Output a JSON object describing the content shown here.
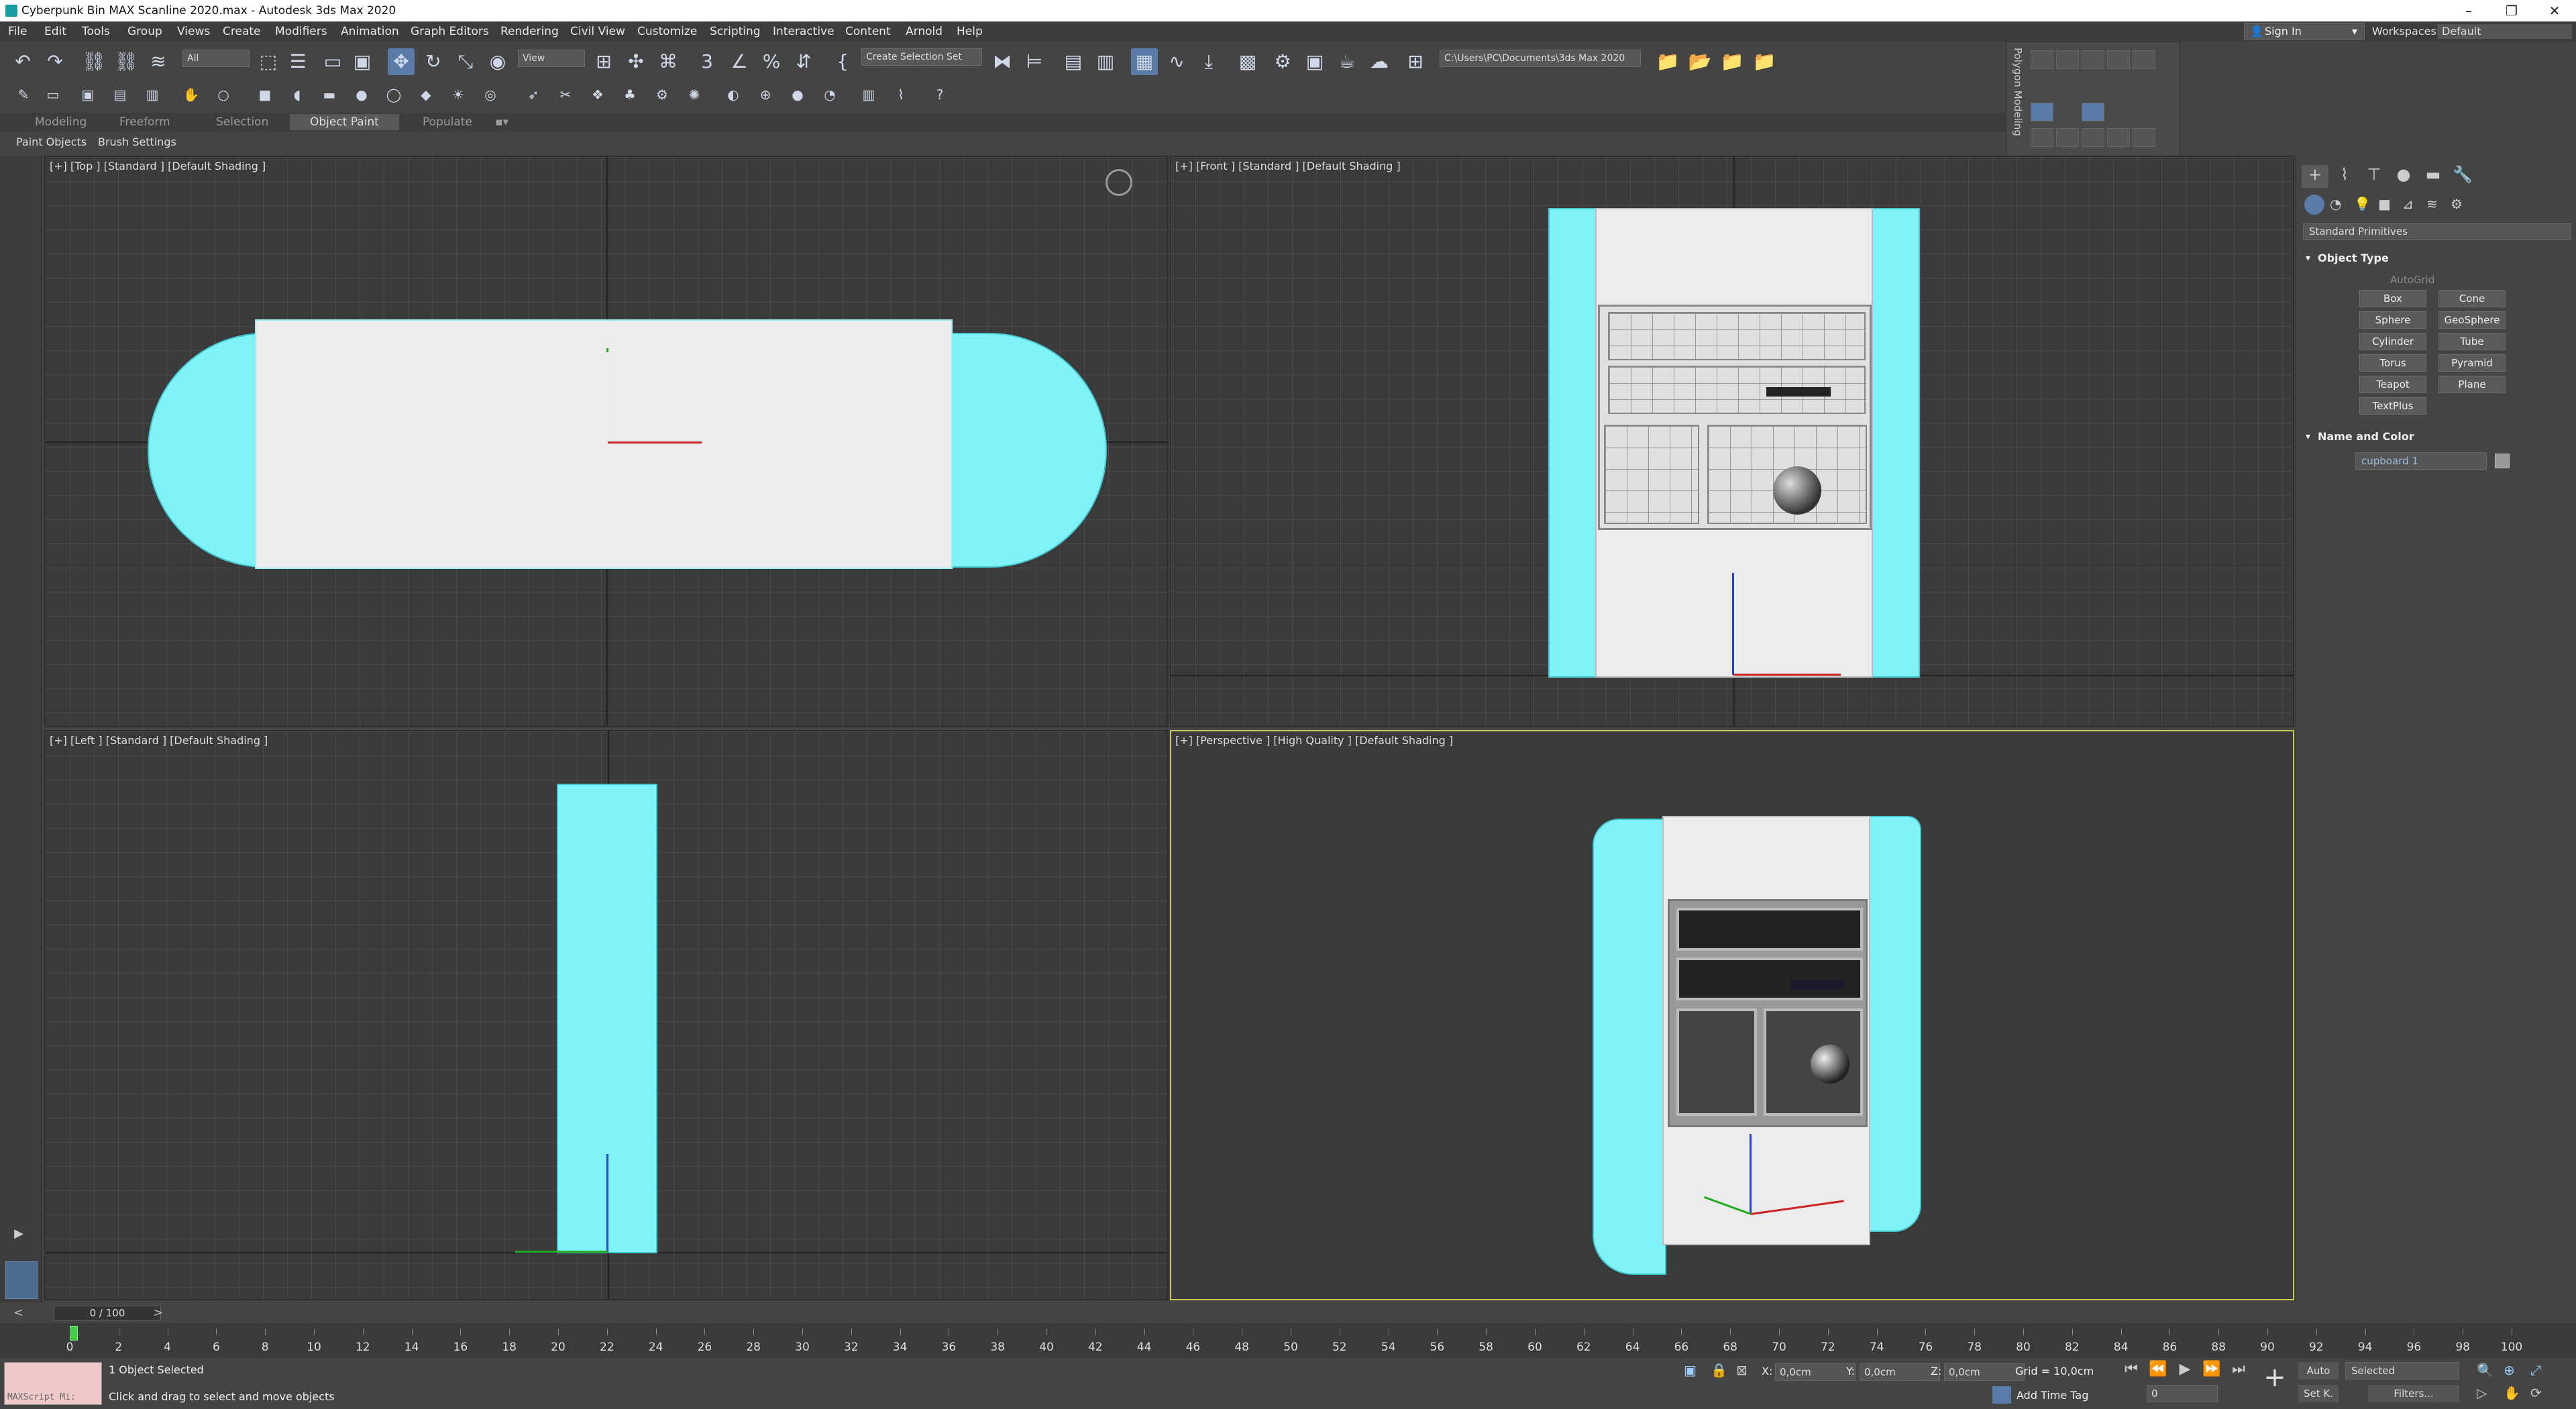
{
  "window": {
    "title": "Cyberpunk Bin MAX Scanline 2020.max - Autodesk 3ds Max 2020",
    "minimize": "–",
    "restore": "❐",
    "close": "✕"
  },
  "menu": [
    "File",
    "Edit",
    "Tools",
    "Group",
    "Views",
    "Create",
    "Modifiers",
    "Animation",
    "Graph Editors",
    "Rendering",
    "Civil View",
    "Customize",
    "Scripting",
    "Interactive",
    "Content",
    "Arnold",
    "Help"
  ],
  "account": {
    "signin": "Sign In",
    "workspaces_label": "Workspaces:",
    "workspace_value": "Default"
  },
  "toolbar": {
    "filter_value": "All",
    "refcoord_value": "View",
    "selection_set_placeholder": "Create Selection Set",
    "project_path": "C:\\Users\\PC\\Documents\\3ds Max 2020"
  },
  "ribbon": {
    "tabs": [
      "Modeling",
      "Freeform",
      "Selection",
      "Object Paint",
      "Populate"
    ],
    "active_tab": "Object Paint",
    "sub": [
      "Paint Objects",
      "Brush Settings"
    ],
    "polygon_panel": "Polygon Modeling"
  },
  "viewports": {
    "top": "[+] [Top ] [Standard ] [Default Shading ]",
    "front": "[+] [Front ] [Standard ] [Default Shading ]",
    "left": "[+] [Left ] [Standard ] [Default Shading ]",
    "perspective": "[+] [Perspective ] [High Quality ] [Default Shading ]"
  },
  "command_panel": {
    "category": "Standard Primitives",
    "object_type_header": "Object Type",
    "autogrid": "AutoGrid",
    "primitives": [
      "Box",
      "Cone",
      "Sphere",
      "GeoSphere",
      "Cylinder",
      "Tube",
      "Torus",
      "Pyramid",
      "Teapot",
      "Plane",
      "TextPlus"
    ],
    "name_color_header": "Name and Color",
    "object_name": "cupboard 1"
  },
  "timeline": {
    "frame": "0 / 100",
    "ticks": [
      "0",
      "2",
      "4",
      "6",
      "8",
      "10",
      "12",
      "14",
      "16",
      "18",
      "20",
      "22",
      "24",
      "26",
      "28",
      "30",
      "32",
      "34",
      "36",
      "38",
      "40",
      "42",
      "44",
      "46",
      "48",
      "50",
      "52",
      "54",
      "56",
      "58",
      "60",
      "62",
      "64",
      "66",
      "68",
      "70",
      "72",
      "74",
      "76",
      "78",
      "80",
      "82",
      "84",
      "86",
      "88",
      "90",
      "92",
      "94",
      "96",
      "98",
      "100"
    ]
  },
  "status": {
    "maxscript": "MAXScript Mi:",
    "selection": "1 Object Selected",
    "prompt": "Click and drag to select and move objects",
    "x_label": "X:",
    "x_value": "0,0cm",
    "y_label": "Y:",
    "y_value": "0,0cm",
    "z_label": "Z:",
    "z_value": "0,0cm",
    "grid": "Grid = 10,0cm",
    "add_time_tag": "Add Time Tag",
    "auto": "Auto",
    "selected": "Selected",
    "set_key": "Set K.",
    "filters": "Filters...",
    "current_frame": "0"
  }
}
